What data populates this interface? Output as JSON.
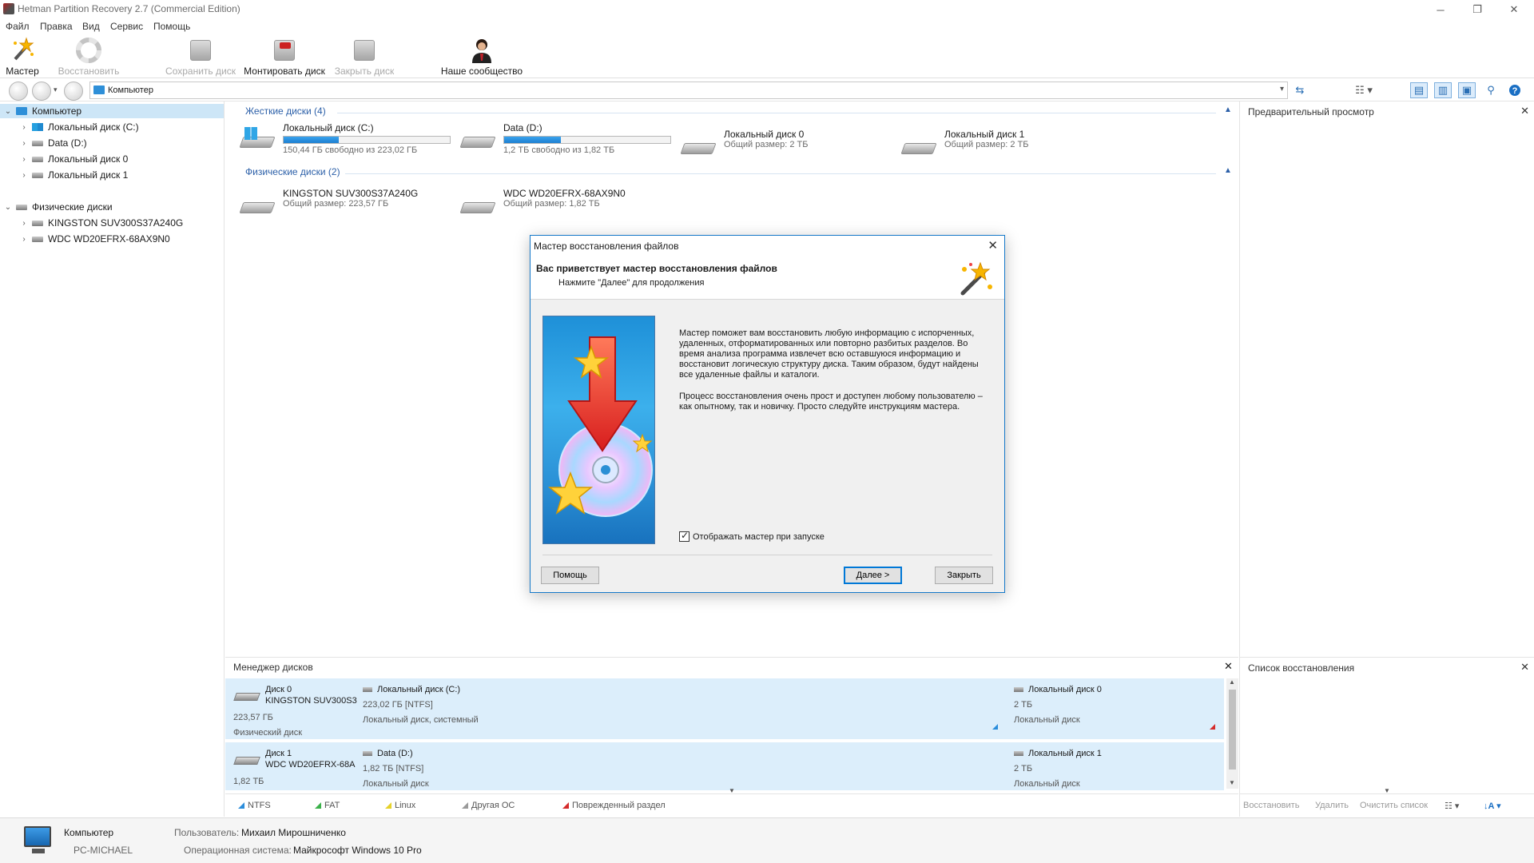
{
  "window": {
    "title": "Hetman Partition Recovery 2.7 (Commercial Edition)",
    "minimize_icon": "minimize-icon",
    "restore_icon": "restore-icon",
    "close_icon": "close-icon"
  },
  "menu": [
    "Файл",
    "Правка",
    "Вид",
    "Сервис",
    "Помощь"
  ],
  "toolbar": {
    "wizard": "Мастер",
    "restore": "Восстановить",
    "save_disk": "Сохранить диск",
    "mount_disk": "Монтировать диск",
    "close_disk": "Закрыть диск",
    "community": "Наше сообщество"
  },
  "address": {
    "value": "Компьютер"
  },
  "tree": {
    "root": "Компьютер",
    "logical": [
      "Локальный диск (C:)",
      "Data (D:)",
      "Локальный диск 0",
      "Локальный диск 1"
    ],
    "physical_root": "Физические диски",
    "physical": [
      "KINGSTON SUV300S37A240G",
      "WDC WD20EFRX-68AX9N0"
    ]
  },
  "main": {
    "hard_disks_header": "Жесткие диски (4)",
    "physical_disks_header": "Физические диски (2)",
    "hard_disks": [
      {
        "name": "Локальный диск (C:)",
        "info": "150,44 ГБ свободно из 223,02 ГБ",
        "used_fraction": 0.33
      },
      {
        "name": "Data (D:)",
        "info": "1,2 ТБ свободно из 1,82 ТБ",
        "used_fraction": 0.34
      },
      {
        "name": "Локальный диск 0",
        "info": "Общий размер: 2 ТБ"
      },
      {
        "name": "Локальный диск 1",
        "info": "Общий размер: 2 ТБ"
      }
    ],
    "physical_disks": [
      {
        "name": "KINGSTON SUV300S37A240G",
        "info": "Общий размер: 223,57 ГБ"
      },
      {
        "name": "WDC WD20EFRX-68AX9N0",
        "info": "Общий размер: 1,82 ТБ"
      }
    ]
  },
  "preview": {
    "title": "Предварительный просмотр"
  },
  "disk_manager": {
    "title": "Менеджер дисков",
    "rows": [
      {
        "disk": "Диск 0",
        "model": "KINGSTON SUV300S3",
        "size": "223,57 ГБ",
        "type": "Физический диск",
        "part1": {
          "name": "Локальный диск (C:)",
          "size": "223,02 ГБ [NTFS]",
          "type": "Локальный диск, системный"
        },
        "part2": {
          "name": "Локальный диск 0",
          "size": "2 ТБ",
          "type": "Локальный диск"
        }
      },
      {
        "disk": "Диск 1",
        "model": "WDC WD20EFRX-68A",
        "size": "1,82 ТБ",
        "part1": {
          "name": "Data (D:)",
          "size": "1,82 ТБ [NTFS]",
          "type": "Локальный диск"
        },
        "part2": {
          "name": "Локальный диск 1",
          "size": "2 ТБ",
          "type": "Локальный диск"
        }
      }
    ],
    "legend": [
      "NTFS",
      "FAT",
      "Linux",
      "Другая ОС",
      "Поврежденный раздел"
    ]
  },
  "recovery_list": {
    "title": "Список восстановления",
    "actions": [
      "Восстановить",
      "Удалить",
      "Очистить список"
    ]
  },
  "status": {
    "computer_label": "Компьютер",
    "computer_name": "PC-MICHAEL",
    "user_label": "Пользователь:",
    "user_value": "Михаил Мирошниченко",
    "os_label": "Операционная система:",
    "os_value": "Майкрософт Windows 10 Pro"
  },
  "dialog": {
    "title": "Мастер восстановления файлов",
    "heading": "Вас приветствует мастер восстановления файлов",
    "subheading": "Нажмите \"Далее\" для продолжения",
    "text1": "Мастер поможет вам восстановить любую информацию с испорченных, удаленных, отформатированных или повторно разбитых разделов. Во время анализа программа извлечет всю оставшуюся информацию и восстановит логическую структуру диска. Таким образом, будут найдены все удаленные файлы и каталоги.",
    "text2": "Процесс восстановления очень прост и доступен любому пользователю – как опытному, так и новичку. Просто следуйте инструкциям мастера.",
    "checkbox": "Отображать мастер при запуске",
    "help_button": "Помощь",
    "next_button": "Далее >",
    "close_button": "Закрыть"
  },
  "colors": {
    "accent": "#1c7fd0",
    "ntfs": "#2b8ddb",
    "fat": "#3bb14a",
    "linux": "#e6d22a",
    "other": "#9a9a9a",
    "damaged": "#d52b2b"
  }
}
